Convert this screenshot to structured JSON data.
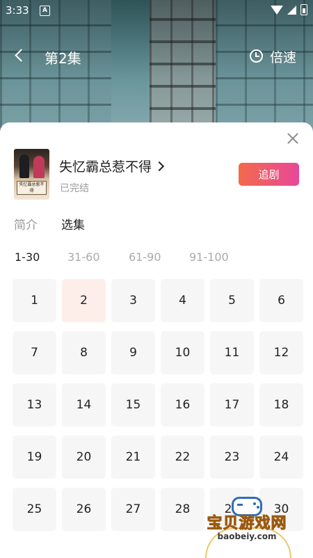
{
  "status_bar": {
    "time": "3:33",
    "notification_icon_text": "A"
  },
  "top_bar": {
    "episode_title": "第2集",
    "speed_label": "倍速"
  },
  "drama": {
    "title": "失忆霸总惹不得",
    "status": "已完结",
    "follow_label": "追剧",
    "poster_text": "失忆霸总惹不得"
  },
  "tabs": [
    {
      "label": "简介",
      "selected": false
    },
    {
      "label": "选集",
      "selected": true
    }
  ],
  "ranges": [
    {
      "label": "1-30",
      "selected": true
    },
    {
      "label": "31-60",
      "selected": false
    },
    {
      "label": "61-90",
      "selected": false
    },
    {
      "label": "91-100",
      "selected": false
    }
  ],
  "episodes": [
    "1",
    "2",
    "3",
    "4",
    "5",
    "6",
    "7",
    "8",
    "9",
    "10",
    "11",
    "12",
    "13",
    "14",
    "15",
    "16",
    "17",
    "18",
    "19",
    "20",
    "21",
    "22",
    "23",
    "24",
    "25",
    "26",
    "27",
    "28",
    "29",
    "30"
  ],
  "current_episode": "2",
  "watermark": {
    "title": "宝贝游戏网",
    "url": "baobeiy.com"
  },
  "colors": {
    "accent_start": "#f36a4a",
    "accent_end": "#e8489a",
    "active_cell": "#fdeee9"
  }
}
